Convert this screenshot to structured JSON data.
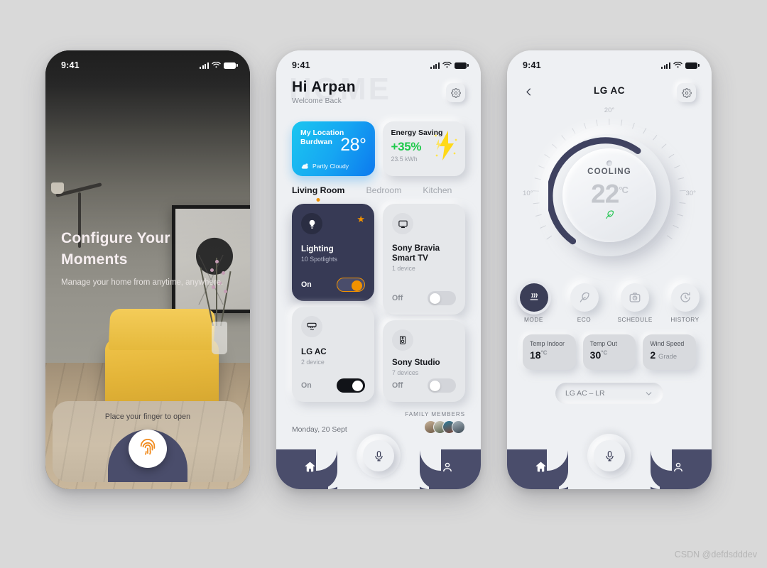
{
  "page": {
    "watermark": "CSDN @defdsdddev",
    "background": "#d9d9d9"
  },
  "colors": {
    "navy": "#4a4d6b",
    "card_dark": "#373a55",
    "accent_orange": "#f29200",
    "green": "#1ec94a",
    "weather_blue": "#16a6f2",
    "surface": "#eef0f3"
  },
  "phone1": {
    "status": {
      "time": "9:41",
      "signal_icon": "signal-bars-icon",
      "wifi_icon": "wifi-icon",
      "battery_icon": "battery-icon"
    },
    "title": "Configure Your Moments",
    "subtitle": "Manage your home from anytime, anywhere.",
    "unlock_label": "Place your finger to open",
    "fingerprint_icon": "fingerprint-icon"
  },
  "phone2": {
    "status": {
      "time": "9:41",
      "signal_icon": "signal-bars-icon",
      "wifi_icon": "wifi-icon",
      "battery_icon": "battery-icon"
    },
    "watermark_text": "HOME",
    "greeting": "Hi  Arpan",
    "welcome": "Welcome Back",
    "settings_icon": "gear-icon",
    "weather": {
      "label": "My Location",
      "city": "Burdwan",
      "temperature": "28°",
      "condition": "Partly Cloudy",
      "condition_icon": "partly-cloudy-icon"
    },
    "energy": {
      "title": "Energy Saving",
      "value": "+35%",
      "kwh": "23.5 kWh",
      "icon": "lightning-bolt-icon"
    },
    "rooms": [
      {
        "label": "Living Room",
        "active": true
      },
      {
        "label": "Bedroom",
        "active": false
      },
      {
        "label": "Kitchen",
        "active": false
      }
    ],
    "devices": [
      {
        "name": "Lighting",
        "meta": "10 Spotlights",
        "state": "On",
        "icon": "lightbulb-icon",
        "favorite": true,
        "theme": "dark"
      },
      {
        "name": "Sony Bravia Smart TV",
        "meta": "1 device",
        "state": "Off",
        "icon": "tv-icon",
        "favorite": false,
        "theme": "lite"
      },
      {
        "name": "LG AC",
        "meta": "2 device",
        "state": "On",
        "icon": "air-conditioner-icon",
        "favorite": false,
        "theme": "lite"
      },
      {
        "name": "Sony Studio",
        "meta": "7 devices",
        "state": "Off",
        "icon": "speaker-icon",
        "favorite": false,
        "theme": "lite"
      }
    ],
    "date": "Monday, 20 Sept",
    "family_label": "FAMILY MEMBERS",
    "family_count": 4,
    "nav": {
      "home_icon": "home-icon",
      "mic_icon": "microphone-icon",
      "profile_icon": "person-icon"
    }
  },
  "phone3": {
    "status": {
      "time": "9:41",
      "signal_icon": "signal-bars-icon",
      "wifi_icon": "wifi-icon",
      "battery_icon": "battery-icon"
    },
    "back_icon": "chevron-left-icon",
    "title": "LG AC",
    "settings_icon": "gear-icon",
    "dial": {
      "mode": "COOLING",
      "temperature": "22",
      "unit": "°C",
      "eco_icon": "leaf-icon",
      "tick_labels": {
        "min": "10°",
        "mid": "20°",
        "max": "30°"
      },
      "range": [
        10,
        30
      ],
      "value": 22
    },
    "modes": [
      {
        "label": "MODE",
        "icon": "heat-waves-icon",
        "active": true
      },
      {
        "label": "ECO",
        "icon": "leaf-icon",
        "active": false
      },
      {
        "label": "SCHEDULE",
        "icon": "timer-camera-icon",
        "active": false
      },
      {
        "label": "HISTORY",
        "icon": "clock-refresh-icon",
        "active": false
      }
    ],
    "stats": [
      {
        "label": "Temp Indoor",
        "value": "18",
        "unit": "°C"
      },
      {
        "label": "Temp Out",
        "value": "30",
        "unit": "°C"
      },
      {
        "label": "Wind Speed",
        "value": "2",
        "unit": "Grade"
      }
    ],
    "selector": {
      "value": "LG AC – LR",
      "chevron_icon": "chevron-down-icon"
    },
    "nav": {
      "home_icon": "home-icon",
      "mic_icon": "microphone-icon",
      "profile_icon": "person-icon"
    }
  }
}
